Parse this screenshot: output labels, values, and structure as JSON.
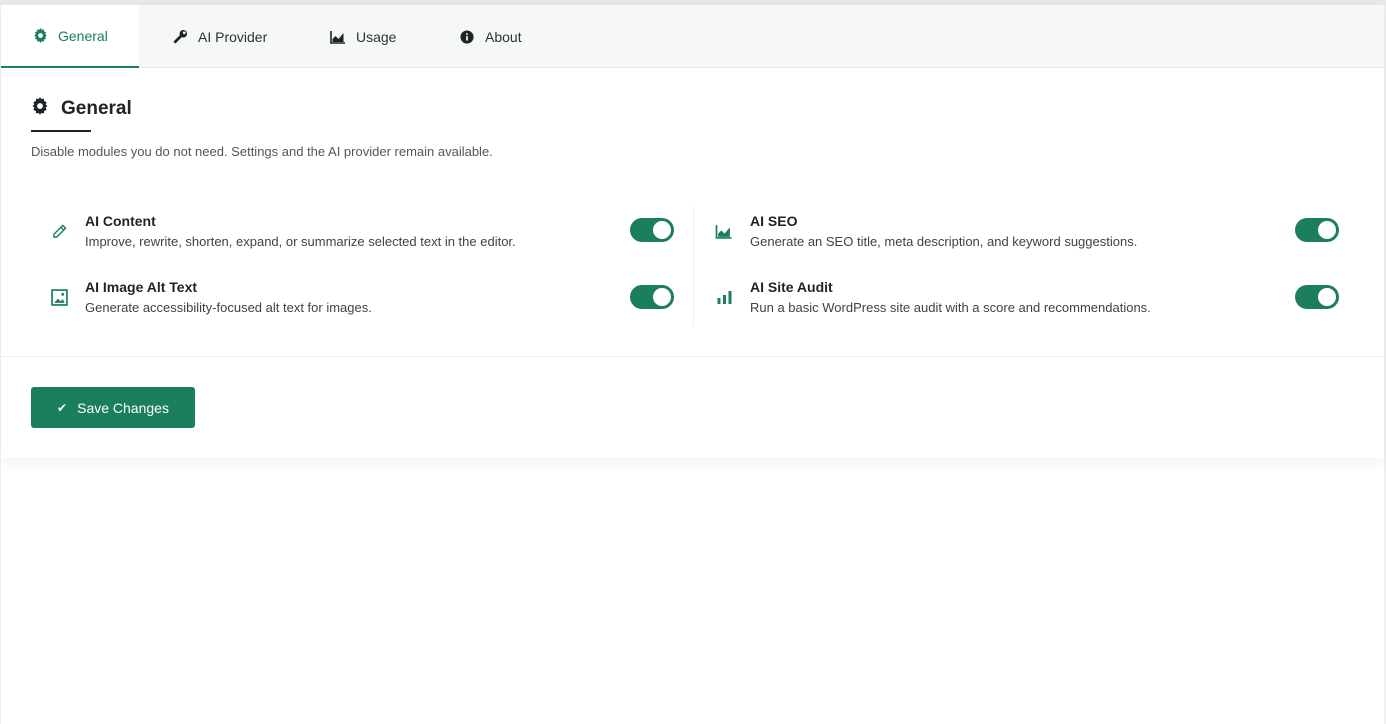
{
  "colors": {
    "accent": "#1a7f5a",
    "text": "#1d2327",
    "muted": "#50575e",
    "tab_bg": "#f6f7f7"
  },
  "tabs": [
    {
      "label": "General",
      "icon": "gear-icon",
      "active": true
    },
    {
      "label": "AI Provider",
      "icon": "wrench-icon",
      "active": false
    },
    {
      "label": "Usage",
      "icon": "area-chart-icon",
      "active": false
    },
    {
      "label": "About",
      "icon": "info-icon",
      "active": false
    }
  ],
  "section": {
    "title": "General",
    "title_icon": "gear-icon",
    "description": "Disable modules you do not need. Settings and the AI provider remain available."
  },
  "modules": [
    {
      "title": "AI Content",
      "description": "Improve, rewrite, shorten, expand, or summarize selected text in the editor.",
      "icon": "pencil-icon",
      "enabled": true
    },
    {
      "title": "AI SEO",
      "description": "Generate an SEO title, meta description, and keyword suggestions.",
      "icon": "area-chart-icon",
      "enabled": true
    },
    {
      "title": "AI Image Alt Text",
      "description": "Generate accessibility-focused alt text for images.",
      "icon": "image-icon",
      "enabled": true
    },
    {
      "title": "AI Site Audit",
      "description": "Run a basic WordPress site audit with a score and recommendations.",
      "icon": "bar-chart-icon",
      "enabled": true
    }
  ],
  "save_button": {
    "label": "Save Changes",
    "icon": "checkmark-icon"
  }
}
